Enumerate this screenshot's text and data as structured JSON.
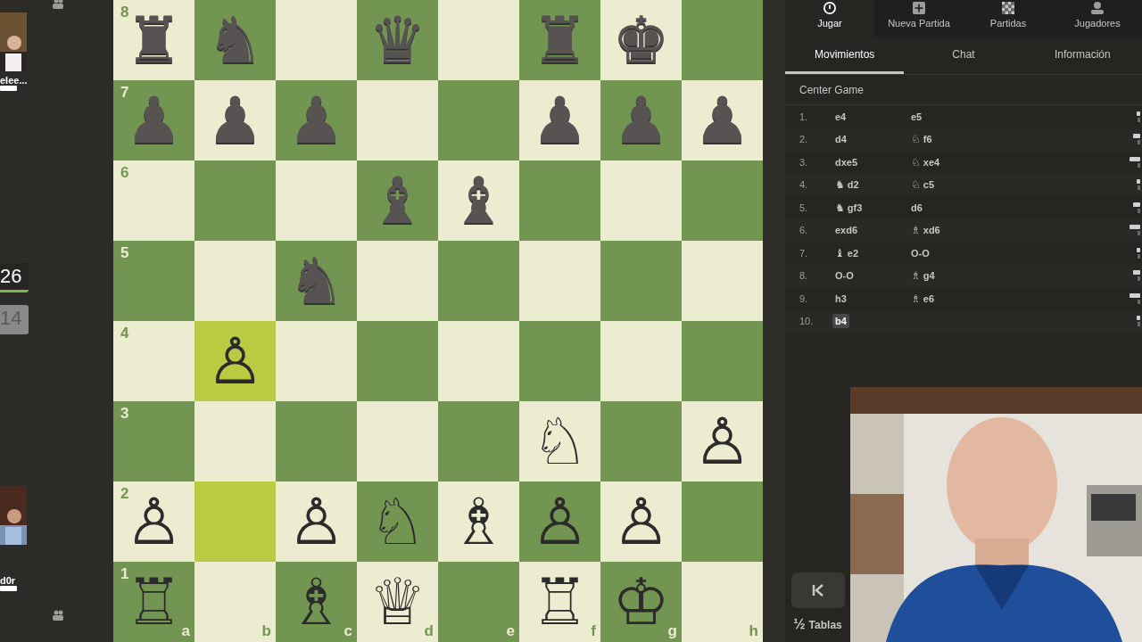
{
  "left_rail": {
    "players": [
      {
        "name": "elee...",
        "kind": "top"
      },
      {
        "name": "d0r",
        "kind": "bottom"
      }
    ],
    "clocks": [
      {
        "time": "26",
        "active": true
      },
      {
        "time": "14",
        "active": false
      }
    ]
  },
  "board": {
    "ranks": [
      {
        "label": "8",
        "squares": [
          {
            "piece": "♜",
            "kind": "black",
            "highlighted": false
          },
          {
            "piece": "♞",
            "kind": "black",
            "highlighted": false
          },
          {
            "highlighted": false
          },
          {
            "piece": "♛",
            "kind": "black",
            "highlighted": false
          },
          {
            "highlighted": false
          },
          {
            "piece": "♜",
            "kind": "black",
            "highlighted": false
          },
          {
            "piece": "♚",
            "kind": "black",
            "highlighted": false
          },
          {
            "highlighted": false
          }
        ]
      },
      {
        "label": "7",
        "squares": [
          {
            "piece": "♟",
            "kind": "black",
            "highlighted": false
          },
          {
            "piece": "♟",
            "kind": "black",
            "highlighted": false
          },
          {
            "piece": "♟",
            "kind": "black",
            "highlighted": false
          },
          {
            "highlighted": false
          },
          {
            "highlighted": false
          },
          {
            "piece": "♟",
            "kind": "black",
            "highlighted": false
          },
          {
            "piece": "♟",
            "kind": "black",
            "highlighted": false
          },
          {
            "piece": "♟",
            "kind": "black",
            "highlighted": false
          }
        ]
      },
      {
        "label": "6",
        "squares": [
          {
            "highlighted": false
          },
          {
            "highlighted": false
          },
          {
            "highlighted": false
          },
          {
            "piece": "♝",
            "kind": "black",
            "highlighted": false
          },
          {
            "piece": "♝",
            "kind": "black",
            "highlighted": false
          },
          {
            "highlighted": false
          },
          {
            "highlighted": false
          },
          {
            "highlighted": false
          }
        ]
      },
      {
        "label": "5",
        "squares": [
          {
            "highlighted": false
          },
          {
            "highlighted": false
          },
          {
            "piece": "♞",
            "kind": "black",
            "highlighted": false
          },
          {
            "highlighted": false
          },
          {
            "highlighted": false
          },
          {
            "highlighted": false
          },
          {
            "highlighted": false
          },
          {
            "highlighted": false
          }
        ]
      },
      {
        "label": "4",
        "squares": [
          {
            "highlighted": false
          },
          {
            "piece": "♙",
            "kind": "white",
            "highlighted": true
          },
          {
            "highlighted": false
          },
          {
            "highlighted": false
          },
          {
            "highlighted": false
          },
          {
            "highlighted": false
          },
          {
            "highlighted": false
          },
          {
            "highlighted": false
          }
        ]
      },
      {
        "label": "3",
        "squares": [
          {
            "highlighted": false
          },
          {
            "highlighted": false
          },
          {
            "highlighted": false
          },
          {
            "highlighted": false
          },
          {
            "highlighted": false
          },
          {
            "piece": "♘",
            "kind": "white",
            "highlighted": false
          },
          {
            "highlighted": false
          },
          {
            "piece": "♙",
            "kind": "white",
            "highlighted": false
          }
        ]
      },
      {
        "label": "2",
        "squares": [
          {
            "piece": "♙",
            "kind": "white",
            "highlighted": false
          },
          {
            "highlighted": true
          },
          {
            "piece": "♙",
            "kind": "white",
            "highlighted": false
          },
          {
            "piece": "♘",
            "kind": "white",
            "highlighted": false
          },
          {
            "piece": "♗",
            "kind": "white",
            "highlighted": false
          },
          {
            "piece": "♙",
            "kind": "white",
            "highlighted": false
          },
          {
            "piece": "♙",
            "kind": "white",
            "highlighted": false
          },
          {
            "highlighted": false
          }
        ]
      },
      {
        "label": "1",
        "squares": [
          {
            "piece": "♖",
            "kind": "white",
            "highlighted": false
          },
          {
            "highlighted": false
          },
          {
            "piece": "♗",
            "kind": "white",
            "highlighted": false
          },
          {
            "piece": "♕",
            "kind": "white",
            "highlighted": false
          },
          {
            "highlighted": false
          },
          {
            "piece": "♖",
            "kind": "white",
            "highlighted": false
          },
          {
            "piece": "♔",
            "kind": "white",
            "highlighted": false
          },
          {
            "highlighted": false
          }
        ]
      }
    ],
    "files": [
      "a",
      "b",
      "c",
      "d",
      "e",
      "f",
      "g",
      "h"
    ]
  },
  "nav": [
    {
      "label": "Jugar",
      "selected": true
    },
    {
      "label": "Nueva Partida",
      "selected": false
    },
    {
      "label": "Partidas",
      "selected": false
    },
    {
      "label": "Jugadores",
      "selected": false
    }
  ],
  "tabs": [
    {
      "label": "Movimientos",
      "selected": true
    },
    {
      "label": "Chat",
      "selected": false
    },
    {
      "label": "Información",
      "selected": false
    }
  ],
  "opening": "Center Game",
  "moves": [
    {
      "number": "1.",
      "white": {
        "san": "e4",
        "selected": false
      },
      "black": {
        "san": "e5",
        "selected": false
      }
    },
    {
      "number": "2.",
      "white": {
        "san": "d4",
        "selected": false
      },
      "black": {
        "piece": "♘",
        "san": "f6",
        "selected": false
      }
    },
    {
      "number": "3.",
      "white": {
        "san": "dxe5",
        "selected": false
      },
      "black": {
        "piece": "♘",
        "san": "xe4",
        "selected": false
      }
    },
    {
      "number": "4.",
      "white": {
        "piece": "♞",
        "san": "d2",
        "selected": false
      },
      "black": {
        "piece": "♘",
        "san": "c5",
        "selected": false
      }
    },
    {
      "number": "5.",
      "white": {
        "piece": "♞",
        "san": "gf3",
        "selected": false
      },
      "black": {
        "san": "d6",
        "selected": false
      }
    },
    {
      "number": "6.",
      "white": {
        "san": "exd6",
        "selected": false
      },
      "black": {
        "piece": "♗",
        "san": "xd6",
        "selected": false
      }
    },
    {
      "number": "7.",
      "white": {
        "piece": "♝",
        "san": "e2",
        "selected": false
      },
      "black": {
        "san": "O-O",
        "selected": false
      }
    },
    {
      "number": "8.",
      "white": {
        "san": "O-O",
        "selected": false
      },
      "black": {
        "piece": "♗",
        "san": "g4",
        "selected": false
      }
    },
    {
      "number": "9.",
      "white": {
        "san": "h3",
        "selected": false
      },
      "black": {
        "piece": "♗",
        "san": "e6",
        "selected": false
      }
    },
    {
      "number": "10.",
      "white": {
        "san": "b4",
        "selected": true
      }
    }
  ],
  "draw": {
    "symbol": "½",
    "label": "Tablas"
  }
}
